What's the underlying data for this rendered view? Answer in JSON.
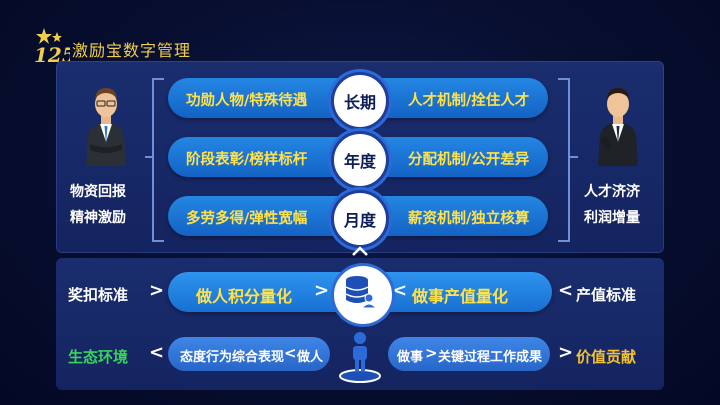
{
  "header": {
    "brand": "激励宝数字管理"
  },
  "top": {
    "left_labels": [
      "物资回报",
      "精神激励"
    ],
    "right_labels": [
      "人才济济",
      "利润增量"
    ],
    "rows": [
      {
        "left": "功勋人物/特殊待遇",
        "center": "长期",
        "right": "人才机制/拴住人才"
      },
      {
        "left": "阶段表彰/榜样标杆",
        "center": "年度",
        "right": "分配机制/公开差异"
      },
      {
        "left": "多劳多得/弹性宽幅",
        "center": "月度",
        "right": "薪资机制/独立核算"
      }
    ]
  },
  "bottom": {
    "row1": {
      "left_label": "奖扣标准",
      "left_pill": "做人积分量化",
      "right_pill": "做事产值量化",
      "right_label": "产值标准"
    },
    "row2": {
      "left_label": "生态环境",
      "left_pill": "态度行为综合表现",
      "left_pill_tail": "做人",
      "right_pill_head": "做事",
      "right_pill": "关键过程工作成果",
      "right_label": "价值贡献"
    },
    "colors": {
      "green_label": "#37d45a",
      "gold_label": "#f2c230",
      "pill_text": "#ffe24a"
    }
  }
}
